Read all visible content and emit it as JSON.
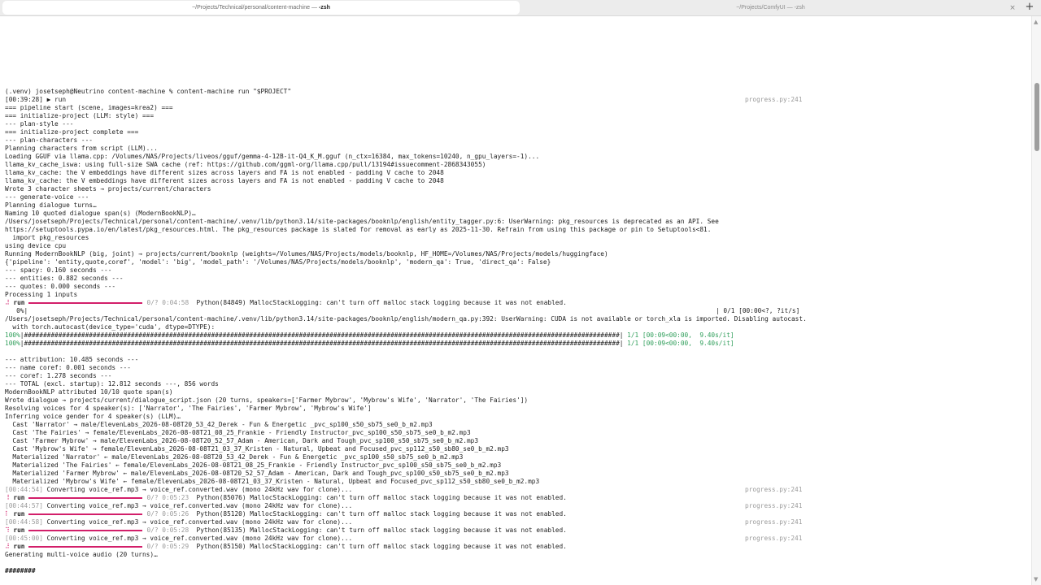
{
  "tabs": [
    {
      "path": "~/Projects/Technical/personal/content-machine — ",
      "cmd": "-zsh"
    },
    {
      "path": "~/Projects/ComfyUI — -zsh"
    }
  ],
  "tab_close_glyph": "×",
  "new_tab_glyph": "+",
  "right_label": "progress.py:241",
  "lines": [
    {
      "text": "(.venv) josetseph@Neutrino content-machine % content-machine run \"$PROJECT\""
    },
    {
      "text": "[00:39:28] ▶ run",
      "right": "progress.py:241"
    },
    {
      "text": "=== pipeline start (scene, images=krea2) ==="
    },
    {
      "text": "=== initialize-project (LLM: style) ==="
    },
    {
      "text": "--- plan-style ---"
    },
    {
      "text": "=== initialize-project complete ==="
    },
    {
      "text": "--- plan-characters ---"
    },
    {
      "text": "Planning characters from script (LLM)..."
    },
    {
      "text": "Loading GGUF via llama.cpp: /Volumes/NAS/Projects/liveos/gguf/gemma-4-12B-it-Q4_K_M.gguf (n_ctx=16384, max_tokens=10240, n_gpu_layers=-1)..."
    },
    {
      "text": "llama_kv_cache_iswa: using full-size SWA cache (ref: https://github.com/ggml-org/llama.cpp/pull/13194#issuecomment-2868343055)"
    },
    {
      "text": "llama_kv_cache: the V embeddings have different sizes across layers and FA is not enabled - padding V cache to 2048"
    },
    {
      "text": "llama_kv_cache: the V embeddings have different sizes across layers and FA is not enabled - padding V cache to 2048"
    },
    {
      "text": "Wrote 3 character sheets → projects/current/characters"
    },
    {
      "text": "--- generate-voice ---"
    },
    {
      "text": "Planning dialogue turns…"
    },
    {
      "text": "Naming 10 quoted dialogue span(s) (ModernBookNLP)…"
    },
    {
      "text": "/Users/josetseph/Projects/Technical/personal/content-machine/.venv/lib/python3.14/site-packages/booknlp/english/entity_tagger.py:6: UserWarning: pkg_resources is deprecated as an API. See"
    },
    {
      "text": "https://setuptools.pypa.io/en/latest/pkg_resources.html. The pkg_resources package is slated for removal as early as 2025-11-30. Refrain from using this package or pin to Setuptools<81."
    },
    {
      "text": "  import pkg_resources"
    },
    {
      "text": "using device cpu"
    },
    {
      "text": "Running ModernBookNLP (big, joint) → projects/current/booknlp (weights=/Volumes/NAS/Projects/models/booknlp, HF_HOME=/Volumes/NAS/Projects/models/huggingface)"
    },
    {
      "text": "{'pipeline': 'entity,quote,coref', 'model': 'big', 'model_path': '/Volumes/NAS/Projects/models/booknlp', 'modern_qa': True, 'direct_qa': False}"
    },
    {
      "text": "--- spacy: 0.160 seconds ---"
    },
    {
      "text": "--- entities: 0.882 seconds ---"
    },
    {
      "text": "--- quotes: 0.000 seconds ---"
    },
    {
      "text": "Processing 1 inputs"
    },
    {
      "kind": "progress",
      "spinner": "⠼",
      "label": "run",
      "bar": "dark",
      "count": "0/? 0:04:58",
      "msg": "Python(84849) MallocStackLogging: can't turn off malloc stack logging because it was not enabled."
    },
    {
      "text": "   0%|",
      "right_text": "| 0/1 [00:00<?, ?it/s]"
    },
    {
      "text": "/Users/josetseph/Projects/Technical/personal/content-machine/.venv/lib/python3.14/site-packages/booknlp/english/modern_qa.py:392: UserWarning: CUDA is not available or torch_xla is imported. Disabling autocast."
    },
    {
      "text": "  with torch.autocast(device_type='cuda', dtype=DTYPE):"
    },
    {
      "kind": "hash",
      "pct": "100%",
      "hashes": "|############################################################################################################################################################|",
      "tail": " 1/1 [00:09<00:00,  9.40s/it]"
    },
    {
      "kind": "hash",
      "pct": "100%",
      "hashes": "|############################################################################################################################################################|",
      "tail": " 1/1 [00:09<00:00,  9.40s/it]"
    },
    {
      "text": ""
    },
    {
      "text": "--- attribution: 10.485 seconds ---"
    },
    {
      "text": "--- name coref: 0.001 seconds ---"
    },
    {
      "text": "--- coref: 1.278 seconds ---"
    },
    {
      "text": "--- TOTAL (excl. startup): 12.812 seconds ---, 856 words"
    },
    {
      "text": "ModernBookNLP attributed 10/10 quote span(s)"
    },
    {
      "text": "Wrote dialogue → projects/current/dialogue_script.json (20 turns, speakers=['Farmer Mybrow', 'Mybrow's Wife', 'Narrator', 'The Fairies'])"
    },
    {
      "text": "Resolving voices for 4 speaker(s): ['Narrator', 'The Fairies', 'Farmer Mybrow', 'Mybrow's Wife']"
    },
    {
      "text": "Inferring voice gender for 4 speaker(s) (LLM)…"
    },
    {
      "text": "  Cast 'Narrator' → male/ElevenLabs_2026-08-08T20_53_42_Derek - Fun & Energetic _pvc_sp100_s50_sb75_se0_b_m2.mp3"
    },
    {
      "text": "  Cast 'The Fairies' → female/ElevenLabs_2026-08-08T21_08_25_Frankie - Friendly Instructor_pvc_sp100_s50_sb75_se0_b_m2.mp3"
    },
    {
      "text": "  Cast 'Farmer Mybrow' → male/ElevenLabs_2026-08-08T20_52_57_Adam - American, Dark and Tough_pvc_sp100_s50_sb75_se0_b_m2.mp3"
    },
    {
      "text": "  Cast 'Mybrow's Wife' → female/ElevenLabs_2026-08-08T21_03_37_Kristen - Natural, Upbeat and Focused_pvc_sp112_s50_sb80_se0_b_m2.mp3"
    },
    {
      "text": "  Materialized 'Narrator' ← male/ElevenLabs_2026-08-08T20_53_42_Derek - Fun & Energetic _pvc_sp100_s50_sb75_se0_b_m2.mp3"
    },
    {
      "text": "  Materialized 'The Fairies' ← female/ElevenLabs_2026-08-08T21_08_25_Frankie - Friendly Instructor_pvc_sp100_s50_sb75_se0_b_m2.mp3"
    },
    {
      "text": "  Materialized 'Farmer Mybrow' ← male/ElevenLabs_2026-08-08T20_52_57_Adam - American, Dark and Tough_pvc_sp100_s50_sb75_se0_b_m2.mp3"
    },
    {
      "text": "  Materialized 'Mybrow's Wife' ← female/ElevenLabs_2026-08-08T21_03_37_Kristen - Natural, Upbeat and Focused_pvc_sp112_s50_sb80_se0_b_m2.mp3"
    },
    {
      "kind": "stamp",
      "ts": "[00:44:54]",
      "msg": " Converting voice_ref.mp3 → voice_ref.converted.wav (mono 24kHz wav for clone)...",
      "right": "progress.py:241"
    },
    {
      "kind": "progress",
      "spinner": "⠸",
      "label": "run",
      "bar": "dark",
      "count": "0/? 0:05:23",
      "msg": "Python(85076) MallocStackLogging: can't turn off malloc stack logging because it was not enabled."
    },
    {
      "kind": "stamp",
      "ts": "[00:44:57]",
      "msg": " Converting voice_ref.mp3 → voice_ref.converted.wav (mono 24kHz wav for clone)...",
      "right": "progress.py:241"
    },
    {
      "kind": "progress",
      "spinner": "⠇",
      "label": "run",
      "bar": "dark",
      "count": "0/? 0:05:26",
      "msg": "Python(85120) MallocStackLogging: can't turn off malloc stack logging because it was not enabled."
    },
    {
      "kind": "stamp",
      "ts": "[00:44:58]",
      "msg": " Converting voice_ref.mp3 → voice_ref.converted.wav (mono 24kHz wav for clone)...",
      "right": "progress.py:241"
    },
    {
      "kind": "progress",
      "spinner": "⠹",
      "label": "run",
      "bar": "dark",
      "count": "0/? 0:05:28",
      "msg": "Python(85135) MallocStackLogging: can't turn off malloc stack logging because it was not enabled."
    },
    {
      "kind": "stamp",
      "ts": "[00:45:00]",
      "msg": " Converting voice_ref.mp3 → voice_ref.converted.wav (mono 24kHz wav for clone)...",
      "right": "progress.py:241"
    },
    {
      "kind": "progress",
      "spinner": "⠼",
      "label": "run",
      "bar": "dark",
      "count": "0/? 0:05:29",
      "msg": "Python(85150) MallocStackLogging: can't turn off malloc stack logging because it was not enabled."
    },
    {
      "text": "Generating multi-voice audio (20 turns)…"
    },
    {
      "text": ""
    },
    {
      "text": "########",
      "bold": true
    }
  ],
  "colors": {
    "accent": "#d21f6a",
    "green": "#2f9e5a",
    "muted": "#9a9a9a"
  }
}
